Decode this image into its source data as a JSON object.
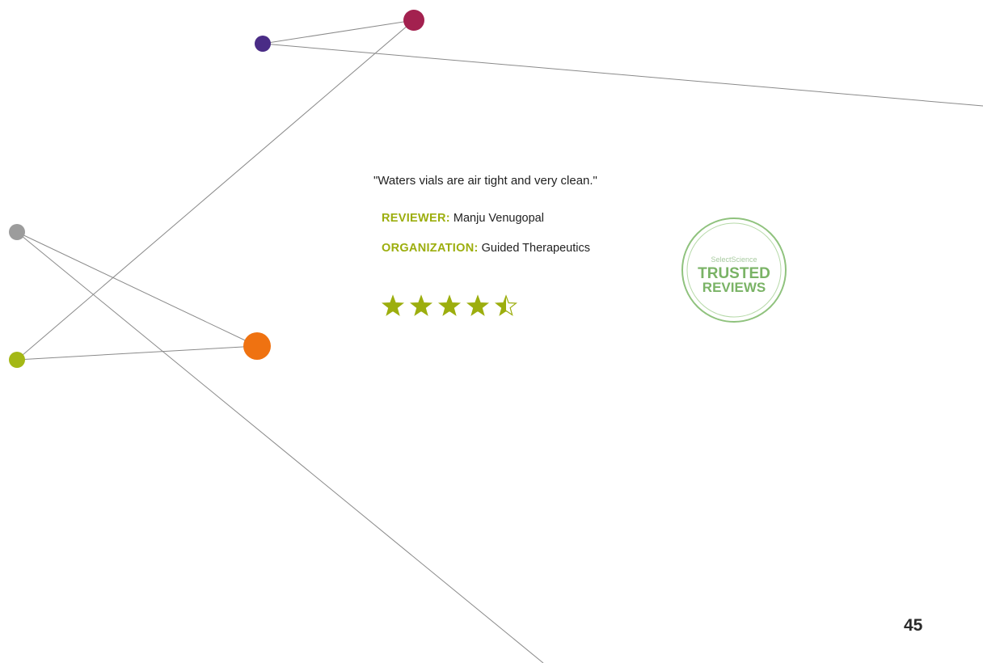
{
  "review": {
    "quote": "\"Waters vials are air tight and very clean.\"",
    "reviewer_label": "REVIEWER:",
    "reviewer_name": "Manju Venugopal",
    "organization_label": "ORGANIZATION:",
    "organization_name": "Guided Therapeutics",
    "rating_stars": 4.5,
    "rating_max": 5
  },
  "badge": {
    "top_text": "SelectScience",
    "line1": "TRUSTED",
    "line2": "REVIEWS"
  },
  "page_number": "45",
  "colors": {
    "accent_green": "#9cae0e",
    "badge_green": "#7ab366",
    "node_magenta": "#a3214f",
    "node_purple": "#4a2c86",
    "node_gray": "#9c9c9c",
    "node_lime": "#a4b816",
    "node_orange": "#ef7211",
    "line_gray": "#8a8a8a"
  }
}
